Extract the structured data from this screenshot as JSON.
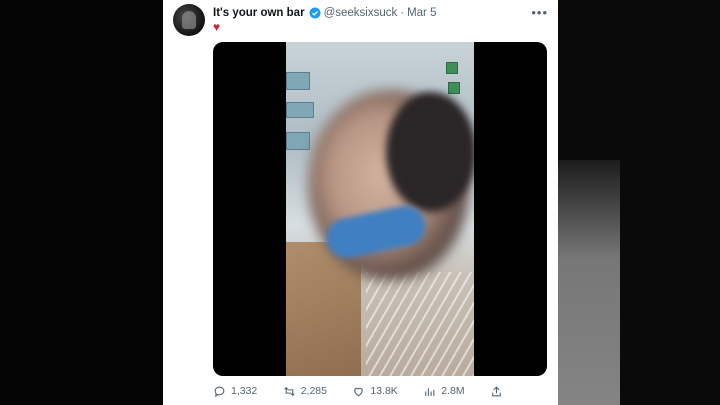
{
  "tweet": {
    "display_name": "It's your own bar",
    "handle": "@seeksixsuck",
    "separator": "·",
    "date": "Mar 5",
    "text": "♥",
    "more_label": "•••",
    "verified": true,
    "accent_color": "#1d9bf0",
    "text_color": "#d0243c"
  },
  "actions": {
    "replies": "1,332",
    "reposts": "2,285",
    "likes": "13.8K",
    "views": "2.8M"
  },
  "icons": {
    "reply": "reply-icon",
    "repost": "repost-icon",
    "like": "like-icon",
    "views": "views-icon",
    "share": "share-icon"
  }
}
